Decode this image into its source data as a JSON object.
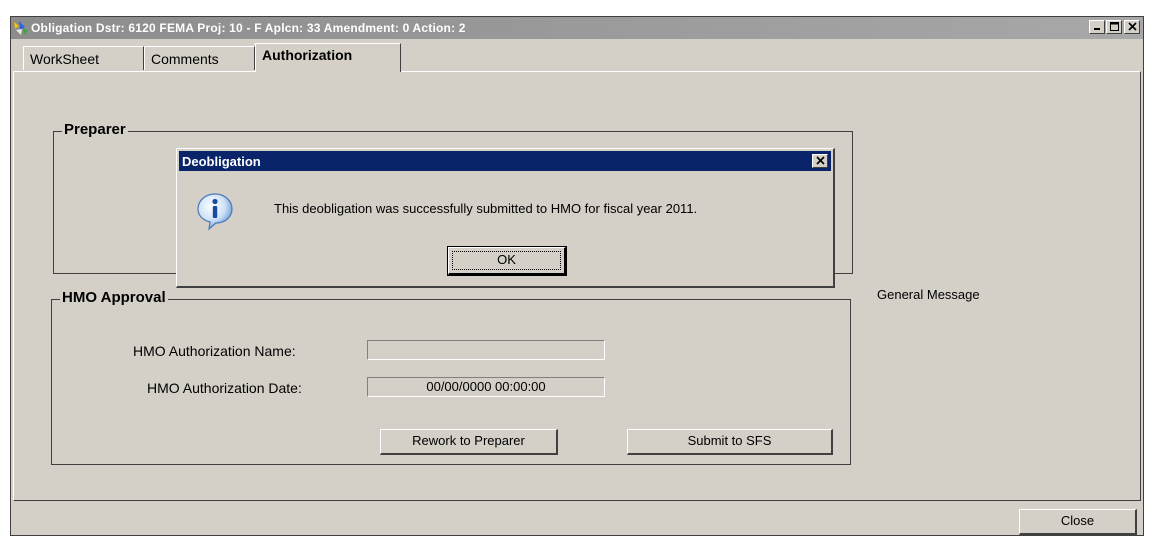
{
  "window": {
    "title": "Obligation   Dstr: 6120  FEMA Proj: 10 - F  Aplcn: 33  Amendment: 0  Action: 2"
  },
  "tabs": [
    {
      "label": "WorkSheet"
    },
    {
      "label": "Comments"
    },
    {
      "label": "Authorization"
    }
  ],
  "preparer": {
    "legend": "Preparer"
  },
  "hmo_approval": {
    "legend": "HMO Approval",
    "name_label": "HMO Authorization Name:",
    "name_value": "",
    "date_label": "HMO Authorization Date:",
    "date_value": "00/00/0000 00:00:00",
    "rework_button": "Rework to Preparer",
    "submit_button": "Submit to SFS"
  },
  "general_message": {
    "label": "General Message"
  },
  "footer": {
    "close_button": "Close"
  },
  "dialog": {
    "title": "Deobligation",
    "message": "This deobligation was successfully submitted to HMO for fiscal year 2011.",
    "ok_button": "OK",
    "icon": "info-icon"
  }
}
